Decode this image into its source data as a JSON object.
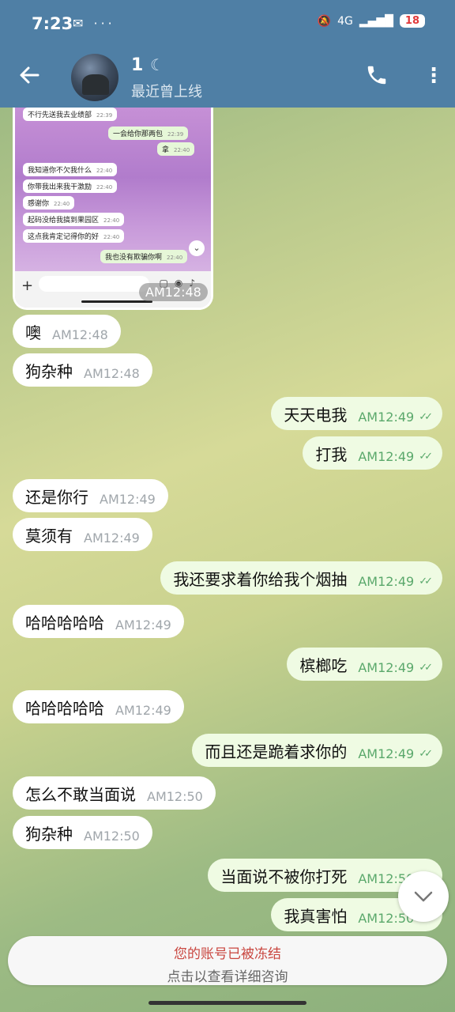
{
  "status_bar": {
    "time": "7:23",
    "left_icons": "✉ ···",
    "network": "4G",
    "battery": "18"
  },
  "header": {
    "back_icon": "arrow-left-icon",
    "name": "1",
    "emoji": "☾",
    "status": "最近曾上线"
  },
  "image_message": {
    "time": "AM12:48",
    "inner_rows": [
      {
        "text": "不行先送我去业绩部",
        "time": "22:39",
        "side": "left"
      },
      {
        "text": "一会给你那两包",
        "time": "22:39",
        "side": "right"
      },
      {
        "text": "拿",
        "time": "22:40",
        "side": "right"
      },
      {
        "text": "我知道你不欠我什么",
        "time": "22:40",
        "side": "left"
      },
      {
        "text": "你带我出来我干激励",
        "time": "22:40",
        "side": "left"
      },
      {
        "text": "感谢你",
        "time": "22:40",
        "side": "left"
      },
      {
        "text": "起码没给我搞到果园区",
        "time": "22:40",
        "side": "left"
      },
      {
        "text": "这点我肯定记得你的好",
        "time": "22:40",
        "side": "left"
      },
      {
        "text": "我也没有欺骗你啊",
        "time": "22:40",
        "side": "right"
      }
    ]
  },
  "messages": [
    {
      "text": "噢",
      "time": "AM12:48",
      "side": "in"
    },
    {
      "text": "狗杂种",
      "time": "AM12:48",
      "side": "in"
    },
    {
      "text": "天天电我",
      "time": "AM12:49",
      "side": "out"
    },
    {
      "text": "打我",
      "time": "AM12:49",
      "side": "out"
    },
    {
      "text": "还是你行",
      "time": "AM12:49",
      "side": "in"
    },
    {
      "text": "莫须有",
      "time": "AM12:49",
      "side": "in"
    },
    {
      "text": "我还要求着你给我个烟抽",
      "time": "AM12:49",
      "side": "out"
    },
    {
      "text": "哈哈哈哈哈",
      "time": "AM12:49",
      "side": "in"
    },
    {
      "text": "槟榔吃",
      "time": "AM12:49",
      "side": "out"
    },
    {
      "text": "哈哈哈哈哈",
      "time": "AM12:49",
      "side": "in"
    },
    {
      "text": "而且还是跪着求你的",
      "time": "AM12:49",
      "side": "out"
    },
    {
      "text": "怎么不敢当面说",
      "time": "AM12:50",
      "side": "in"
    },
    {
      "text": "狗杂种",
      "time": "AM12:50",
      "side": "in"
    },
    {
      "text": "当面说不被你打死",
      "time": "AM12:50",
      "side": "out"
    },
    {
      "text": "我真害怕",
      "time": "AM12:50",
      "side": "out"
    }
  ],
  "banner": {
    "title": "您的账号已被冻结",
    "subtitle": "点击以查看详细咨询"
  },
  "colors": {
    "header": "#4f7fa5",
    "outgoing_bubble": "#effbe3",
    "incoming_bubble": "#ffffff",
    "freeze_text": "#c9463f"
  }
}
